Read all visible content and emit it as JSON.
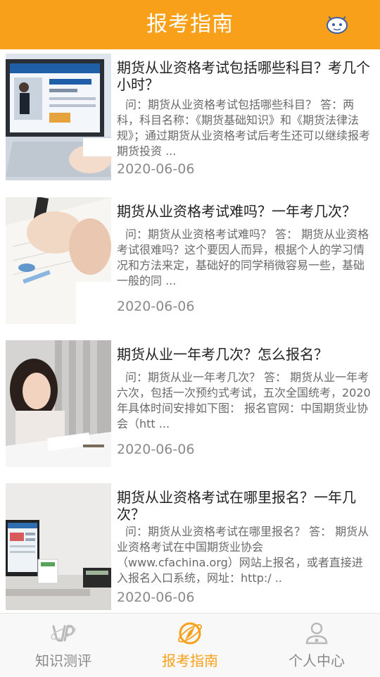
{
  "header": {
    "title": "报考指南",
    "icon": "message-robot-icon"
  },
  "articles": [
    {
      "title": "期货从业资格考试包括哪些科目？考几个小时？",
      "summary": "问：期货从业资格考试包括哪些科目？ 答：两科，科目名称：《期货基础知识》和《期货法律法规》；通过期货从业资格考试后考生还可以继续报考期货投资 ...",
      "date": "2020-06-06",
      "thumbnail": "laptop-website-photo"
    },
    {
      "title": "期货从业资格考试难吗？一年考几次？",
      "summary": "问：期货从业资格考试难吗？ 答： 期货从业资格考试很难吗？这个要因人而异，根据个人的学习情况和方法来定，基础好的同学稍微容易一些，基础一般的同 ...",
      "date": "2020-06-06",
      "thumbnail": "writing-notes-photo"
    },
    {
      "title": "期货从业一年考几次？怎么报名？",
      "summary": "问：期货从业一年考几次？ 答： 期货从业一年考六次，包括一次预约式考试，五次全国统考，2020年具体时间安排如下图： 报名官网：中国期货业协会（htt ...",
      "date": "2020-06-06",
      "thumbnail": "student-studying-photo"
    },
    {
      "title": "期货从业资格考试在哪里报名？一年几次？",
      "summary": "问：期货从业资格考试在哪里报名？ 答： 期货从业资格考试在中国期货业协会（www.cfachina.org）网站上报名，或者直接进入报名入口系统，网址：http:/ ..",
      "date": "2020-06-06",
      "thumbnail": "desk-monitor-photo"
    }
  ],
  "tabs": [
    {
      "label": "知识测评",
      "icon": "up-logo-icon",
      "active": false
    },
    {
      "label": "报考指南",
      "icon": "compass-guide-icon",
      "active": true
    },
    {
      "label": "个人中心",
      "icon": "user-profile-icon",
      "active": false
    }
  ],
  "colors": {
    "accent": "#F9A01B",
    "inactive": "#8a8a8a",
    "title_text": "#222222"
  }
}
